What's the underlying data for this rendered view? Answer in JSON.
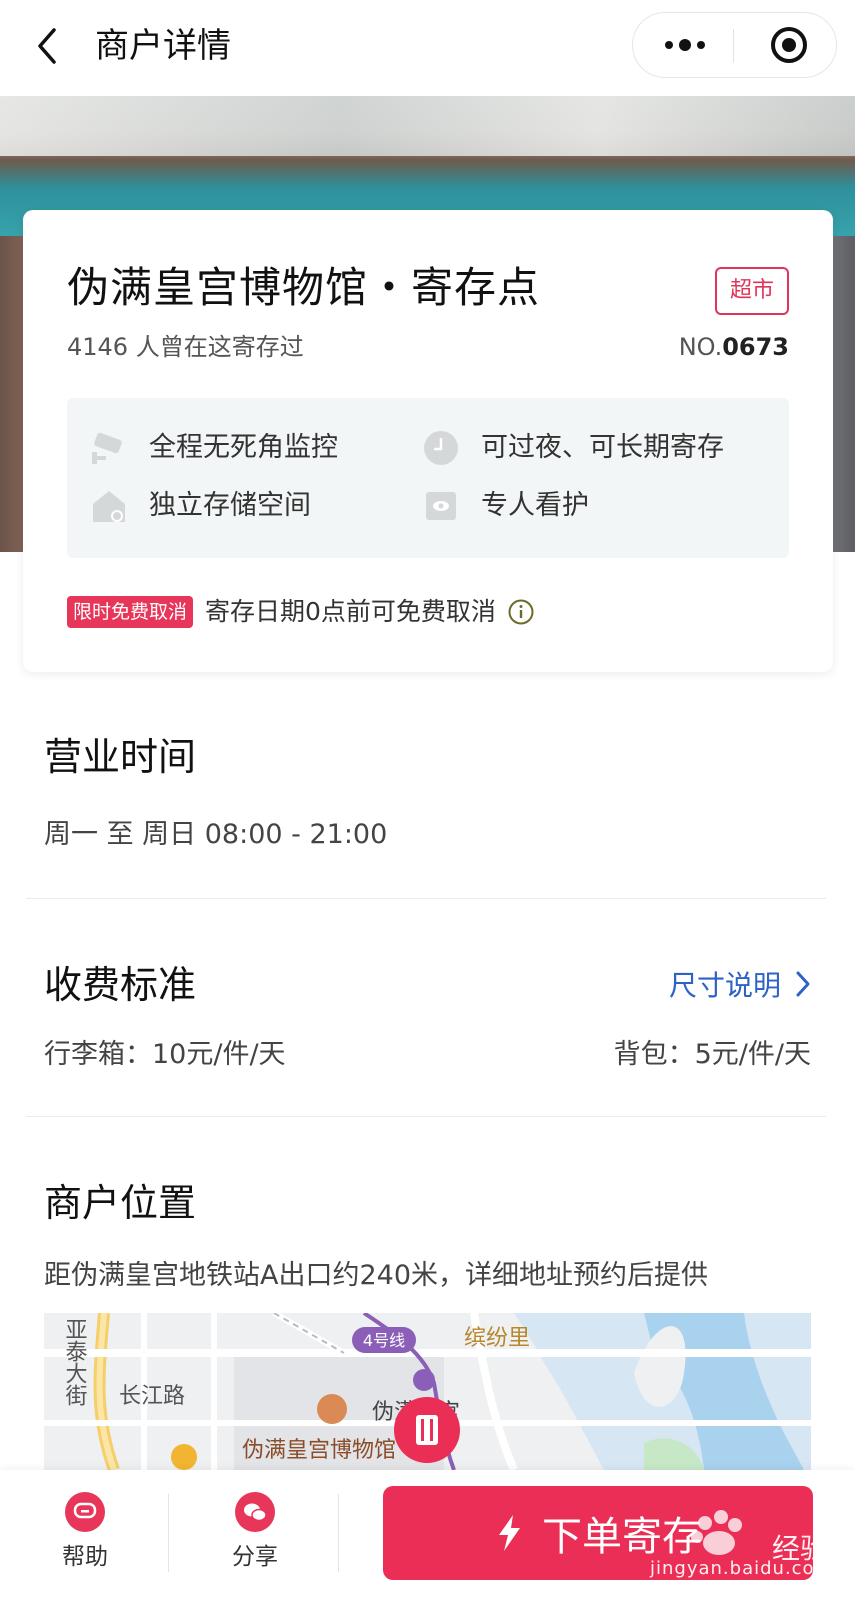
{
  "nav": {
    "title": "商户详情"
  },
  "card": {
    "name": "伪满皇宫博物馆・寄存点",
    "category_tag": "超市",
    "visitors_text": "4146 人曾在这寄存过",
    "store_no_prefix": "NO.",
    "store_no": "0673",
    "features": [
      {
        "icon": "camera-icon",
        "text": "全程无死角监控"
      },
      {
        "icon": "clock-icon",
        "text": "可过夜、可长期寄存"
      },
      {
        "icon": "house-icon",
        "text": "独立存储空间"
      },
      {
        "icon": "eye-icon",
        "text": "专人看护"
      }
    ],
    "promo_badge": "限时免费取消",
    "promo_text": "寄存日期0点前可免费取消"
  },
  "hours": {
    "title": "营业时间",
    "text": "周一 至 周日 08:00 - 21:00"
  },
  "pricing": {
    "title": "收费标准",
    "size_link": "尺寸说明",
    "luggage": "行李箱：10元/件/天",
    "backpack": "背包：5元/件/天"
  },
  "location": {
    "title": "商户位置",
    "text": "距伪满皇宫地铁站A出口约240米，详细地址预约后提供",
    "map": {
      "labels": {
        "street_v": "亚泰大街",
        "changjiang": "长江路",
        "line4": "4号线",
        "binfenli": "缤纷里",
        "palace": "伪满皇宫",
        "museum": "伪满皇宫博物馆"
      }
    }
  },
  "bottom": {
    "help": "帮助",
    "share": "分享",
    "order": "下单寄存"
  },
  "watermark": {
    "brand": "经验",
    "url": "jingyan.baidu.com"
  },
  "colors": {
    "accent": "#ea2e55",
    "link": "#2f62c6",
    "feature_bg": "#f2f6f6"
  }
}
